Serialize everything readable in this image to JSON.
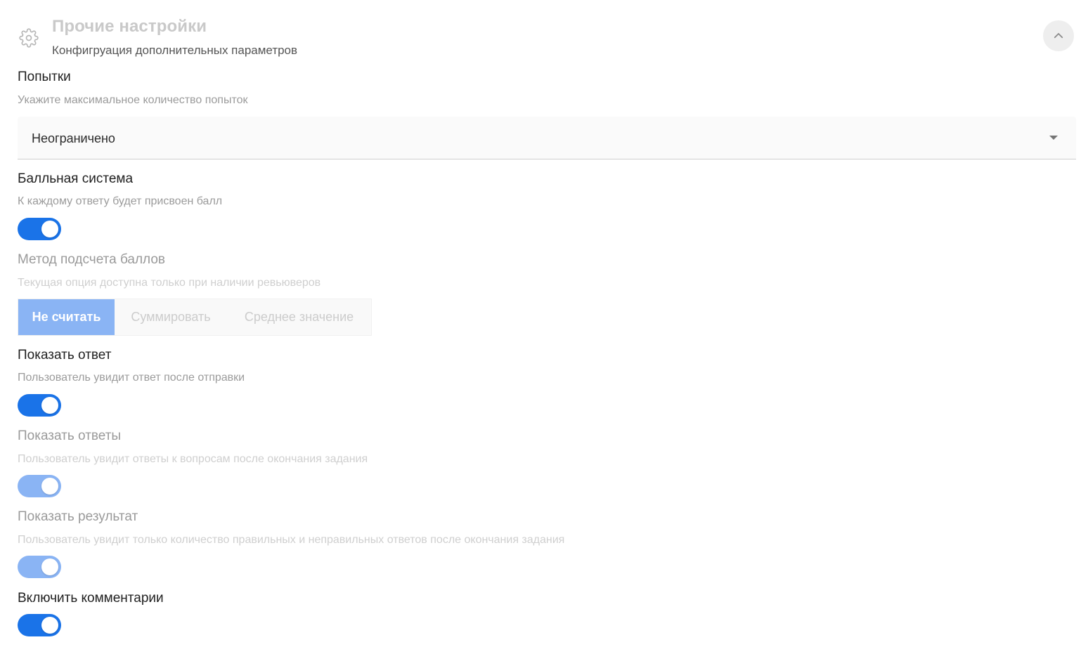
{
  "header": {
    "title": "Прочие настройки",
    "subtitle": "Конфигруация дополнительных параметров"
  },
  "attempts": {
    "title": "Попытки",
    "description": "Укажите максимальное количество попыток",
    "selected": "Неограничено"
  },
  "scoring": {
    "title": "Балльная система",
    "description": "К каждому ответу будет присвоен балл",
    "enabled": true
  },
  "scoring_method": {
    "title": "Метод подсчета баллов",
    "description": "Текущая опция доступна только при наличии ревьюверов",
    "options": [
      "Не считать",
      "Суммировать",
      "Среднее значение"
    ],
    "selected_index": 0
  },
  "show_answer": {
    "title": "Показать ответ",
    "description": "Пользователь увидит ответ после отправки",
    "enabled": true
  },
  "show_answers": {
    "title": "Показать ответы",
    "description": "Пользователь увидит ответы к вопросам после окончания задания",
    "enabled": true,
    "disabled": true
  },
  "show_result": {
    "title": "Показать результат",
    "description": "Пользователь увидит только количество правильных и неправильных ответов после окончания задания",
    "enabled": true,
    "disabled": true
  },
  "comments": {
    "title": "Включить комментарии",
    "enabled": true
  },
  "colors": {
    "accent": "#1a73e8",
    "accent_disabled": "#8ab4f4"
  },
  "icons": {
    "header": "gear-icon",
    "collapse": "chevron-up-icon",
    "select_arrow": "caret-down-icon"
  }
}
